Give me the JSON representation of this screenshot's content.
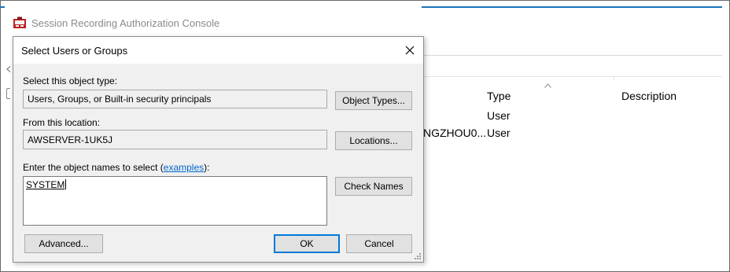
{
  "console": {
    "title": "Session Recording Authorization Console",
    "columns": {
      "type": "Type",
      "description": "Description"
    },
    "rows": [
      {
        "name": "",
        "type": "User"
      },
      {
        "name": "NGZHOU0...",
        "type": "User"
      }
    ]
  },
  "dialog": {
    "title": "Select Users or Groups",
    "object_type_label": "Select this object type:",
    "object_type_value": "Users, Groups, or Built-in security principals",
    "object_types_button": "Object Types...",
    "location_label": "From this location:",
    "location_value": "AWSERVER-1UK5J",
    "locations_button": "Locations...",
    "names_label_prefix": "Enter the object names to select (",
    "names_label_link": "examples",
    "names_label_suffix": "):",
    "names_value": "SYSTEM",
    "check_names_button": "Check Names",
    "advanced_button": "Advanced...",
    "ok_button": "OK",
    "cancel_button": "Cancel"
  },
  "colors": {
    "accent": "#1a73b8",
    "dialog_bg": "#f0f0f0",
    "link": "#0066cc",
    "default_button_border": "#0078d7"
  },
  "icons": [
    "console-app-icon",
    "close-icon",
    "sort-ascending-icon",
    "resize-grip-icon"
  ]
}
